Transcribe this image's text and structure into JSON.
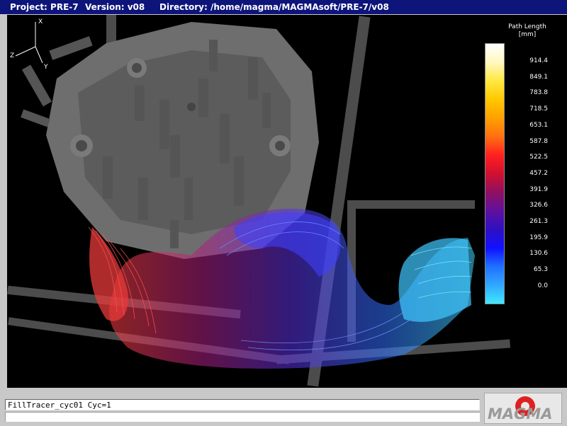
{
  "titlebar": {
    "project": "Project: PRE-7",
    "version": "Version: v08",
    "directory": "Directory: /home/magma/MAGMAsoft/PRE-7/v08"
  },
  "legend": {
    "title_line1": "Path Length",
    "title_line2": "[mm]",
    "labels": [
      "914.4",
      "849.1",
      "783.8",
      "718.5",
      "653.1",
      "587.8",
      "522.5",
      "457.2",
      "391.9",
      "326.6",
      "261.3",
      "195.9",
      "130.6",
      "65.3",
      "0.0"
    ],
    "colors": [
      "#ffffff",
      "#fff8c0",
      "#ffe840",
      "#ffc800",
      "#ffa000",
      "#ff7010",
      "#ff2020",
      "#d01030",
      "#901060",
      "#6010a0",
      "#3010c0",
      "#1010ff",
      "#2070ff",
      "#30a8ff",
      "#40e8ff"
    ]
  },
  "axes": {
    "x": "X",
    "y": "Y",
    "z": "Z"
  },
  "status": {
    "message": "FillTracer_cyc01 Cyc=1"
  },
  "logo": {
    "text": "MAGMA",
    "brand_color": "#e02020"
  }
}
